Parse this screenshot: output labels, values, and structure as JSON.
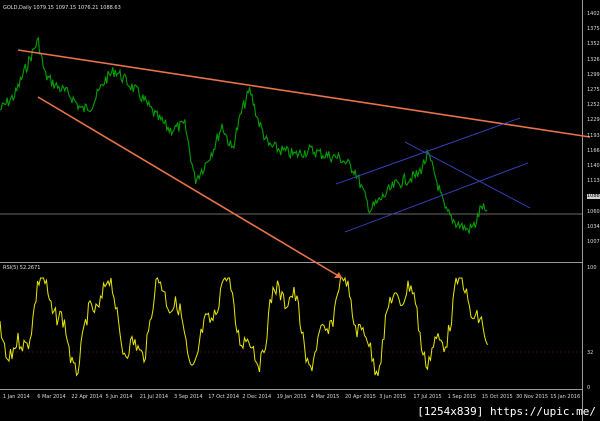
{
  "chart_header": {
    "symbol_tf": "GOLD,Daily",
    "ohlc": "1079.15 1097.15 1076.21 1088.63"
  },
  "rsi_header": "RSI(5) 52.2671",
  "watermark": "[1254x839] https://upic.me/",
  "price_axis": [
    "1402",
    "1375",
    "1352",
    "1326",
    "1299",
    "1275",
    "1252",
    "1229",
    "1193",
    "1166",
    "1140",
    "1113",
    "1088",
    "1060",
    "1034",
    "1007"
  ],
  "price_axis_highlight": "1088",
  "rsi_axis": [
    "100",
    "32",
    "0"
  ],
  "date_axis": [
    "1 Jan 2014",
    "6 Mar 2014",
    "22 Apr 2014",
    "5 Jun 2014",
    "21 Jul 2014",
    "3 Sep 2014",
    "17 Oct 2014",
    "2 Dec 2014",
    "19 Jan 2015",
    "4 Mar 2015",
    "20 Apr 2015",
    "3 Jun 2015",
    "17 Jul 2015",
    "1 Sep 2015",
    "15 Oct 2015",
    "30 Nov 2015",
    "15 Jan 2016"
  ],
  "colors": {
    "price_line": "#00a000",
    "rsi_line": "#e8e800",
    "trendline": "#e8724a",
    "channel": "#3a46c8",
    "background": "#000000",
    "grid_text": "#d8d8d8"
  }
}
